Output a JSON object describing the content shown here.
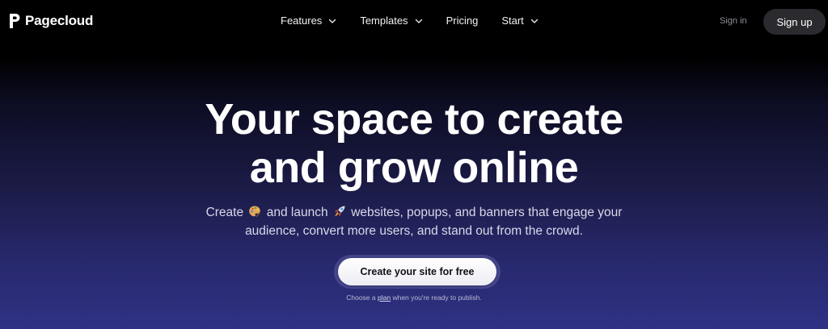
{
  "header": {
    "brand": "Pagecloud",
    "nav": [
      {
        "label": "Features",
        "has_dropdown": true
      },
      {
        "label": "Templates",
        "has_dropdown": true
      },
      {
        "label": "Pricing",
        "has_dropdown": false
      },
      {
        "label": "Start",
        "has_dropdown": true
      }
    ],
    "sign_in": "Sign in",
    "sign_up": "Sign up"
  },
  "hero": {
    "title_line1": "Your space to create",
    "title_line2": "and grow online",
    "subtitle": {
      "part1": "Create",
      "emoji1": "palette-emoji",
      "part2": "and launch",
      "emoji2": "rocket-emoji",
      "part3": "websites, popups, and banners that engage your",
      "line2": "audience, convert more users, and stand out from the crowd."
    },
    "cta_label": "Create your site for free",
    "note_before": "Choose a",
    "note_link": "plan",
    "note_after": "when you're ready to publish."
  },
  "colors": {
    "background_top": "#000000",
    "background_bottom": "#2f3185",
    "cta_background": "#ffffff",
    "sign_up_background": "#2b2b2f"
  }
}
